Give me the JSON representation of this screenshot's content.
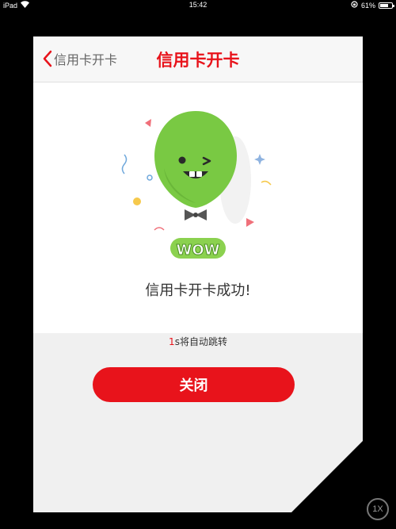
{
  "status_bar": {
    "device": "iPad",
    "time": "15:42",
    "battery": "61%",
    "battery_level": 0.61
  },
  "header": {
    "back_label": "信用卡开卡",
    "title": "信用卡开卡"
  },
  "main": {
    "illustration_text": "WOW",
    "success_message": "信用卡开卡成功!",
    "countdown_number": "1",
    "countdown_text": "s将自动跳转"
  },
  "close_button": {
    "label": "关闭"
  },
  "zoom_badge": "1X",
  "colors": {
    "accent": "#e8131b",
    "balloon": "#79c943",
    "background": "#000000"
  }
}
